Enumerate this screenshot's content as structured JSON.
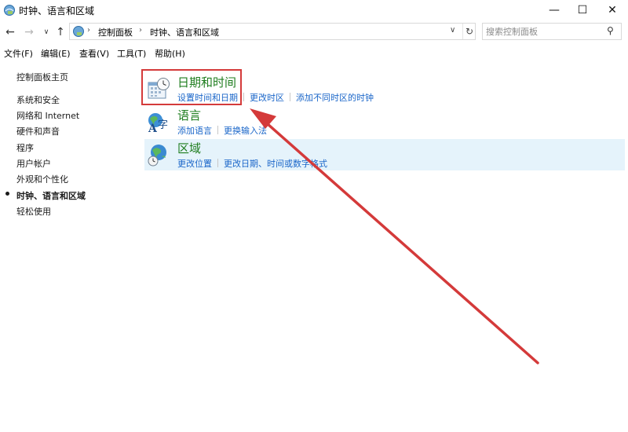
{
  "window": {
    "title": "时钟、语言和区域",
    "minimize": "—",
    "maximize": "☐",
    "close": "✕"
  },
  "address": {
    "back": "←",
    "forward": "→",
    "history": "∨",
    "up": "↑",
    "sep": "›",
    "crumbs": [
      "控制面板",
      "时钟、语言和区域"
    ],
    "dropdown": "∨",
    "refresh": "↻",
    "search_placeholder": "搜索控制面板",
    "search_glyph": "⚲"
  },
  "menu": [
    "文件(F)",
    "编辑(E)",
    "查看(V)",
    "工具(T)",
    "帮助(H)"
  ],
  "sidebar": {
    "home": "控制面板主页",
    "items": [
      "系统和安全",
      "网络和 Internet",
      "硬件和声音",
      "程序",
      "用户帐户",
      "外观和个性化",
      "时钟、语言和区域",
      "轻松使用"
    ],
    "active_index": 6
  },
  "categories": [
    {
      "title": "日期和时间",
      "icon": "calendar-clock-icon",
      "links": [
        "设置时间和日期",
        "更改时区",
        "添加不同时区的时钟"
      ]
    },
    {
      "title": "语言",
      "icon": "language-icon",
      "links": [
        "添加语言",
        "更换输入法"
      ]
    },
    {
      "title": "区域",
      "icon": "globe-clock-icon",
      "links": [
        "更改位置",
        "更改日期、时间或数字格式"
      ]
    }
  ],
  "annotation": {
    "color": "#d43a3a"
  },
  "colors": {
    "category_title": "#1e7d1e",
    "link": "#1a66c9",
    "hover_bg": "#e5f3fb"
  }
}
